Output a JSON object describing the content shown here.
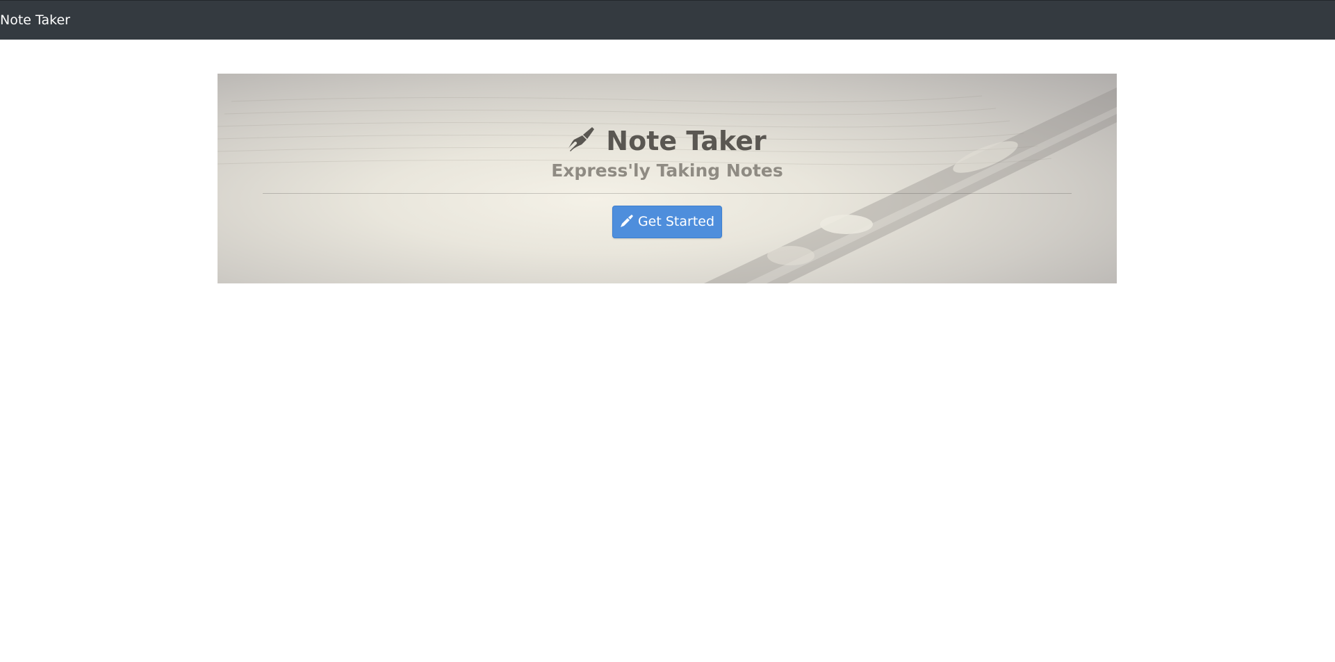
{
  "navbar": {
    "brand": "Note Taker"
  },
  "hero": {
    "title": "Note Taker",
    "subtitle": "Express'ly Taking Notes",
    "title_icon": "fountain-pen-icon",
    "cta_label": "Get Started",
    "cta_icon": "pencil-icon"
  },
  "colors": {
    "navbar_bg": "#343a40",
    "button_bg": "#4e8edc"
  }
}
